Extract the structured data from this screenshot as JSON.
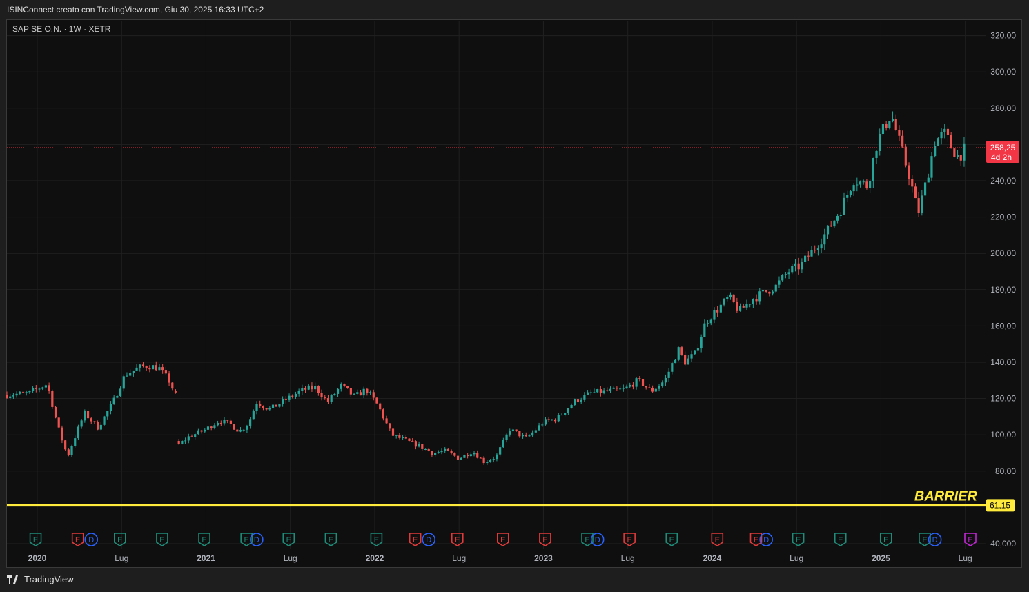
{
  "header": {
    "caption": "ISINConnect creato con TradingView.com, Giu 30, 2025 16:33 UTC+2"
  },
  "footer": {
    "brand": "TradingView"
  },
  "colors": {
    "up": "#26a69a",
    "down": "#ef5350",
    "barrier": "#ffeb3b",
    "price_label_bg": "#f23645",
    "grid": "#1f1f1f",
    "event_e_green": "#1e8c78",
    "event_e_red": "#e03a3a",
    "event_d_blue": "#2962ff",
    "event_e_purple": "#c026d3"
  },
  "chart_data": {
    "type": "candlestick",
    "title": "SAP SE O.N. · 1W · XETR",
    "xlim": [
      2019.82,
      2025.62
    ],
    "ylim": [
      40,
      320
    ],
    "x_ticks": [
      {
        "label": "2020",
        "x": 2020.0,
        "bold": true
      },
      {
        "label": "Lug",
        "x": 2020.5,
        "bold": false
      },
      {
        "label": "2021",
        "x": 2021.0,
        "bold": true
      },
      {
        "label": "Lug",
        "x": 2021.5,
        "bold": false
      },
      {
        "label": "2022",
        "x": 2022.0,
        "bold": true
      },
      {
        "label": "Lug",
        "x": 2022.5,
        "bold": false
      },
      {
        "label": "2023",
        "x": 2023.0,
        "bold": true
      },
      {
        "label": "Lug",
        "x": 2023.5,
        "bold": false
      },
      {
        "label": "2024",
        "x": 2024.0,
        "bold": true
      },
      {
        "label": "Lug",
        "x": 2024.5,
        "bold": false
      },
      {
        "label": "2025",
        "x": 2025.0,
        "bold": true
      },
      {
        "label": "Lug",
        "x": 2025.5,
        "bold": false
      }
    ],
    "y_ticks": [
      {
        "label": "320,00",
        "v": 320
      },
      {
        "label": "300,00",
        "v": 300
      },
      {
        "label": "280,00",
        "v": 280
      },
      {
        "label": "260,00",
        "v": 260
      },
      {
        "label": "240,00",
        "v": 240
      },
      {
        "label": "220,00",
        "v": 220
      },
      {
        "label": "200,00",
        "v": 200
      },
      {
        "label": "180,00",
        "v": 180
      },
      {
        "label": "160,00",
        "v": 160
      },
      {
        "label": "140,00",
        "v": 140
      },
      {
        "label": "120,00",
        "v": 120
      },
      {
        "label": "100,00",
        "v": 100
      },
      {
        "label": "80,00",
        "v": 80
      },
      {
        "label": "40,000",
        "v": 40
      }
    ],
    "anchors": [
      [
        2019.82,
        122
      ],
      [
        2019.95,
        123
      ],
      [
        2020.06,
        128
      ],
      [
        2020.12,
        105
      ],
      [
        2020.18,
        88
      ],
      [
        2020.22,
        98
      ],
      [
        2020.28,
        112
      ],
      [
        2020.36,
        104
      ],
      [
        2020.45,
        118
      ],
      [
        2020.52,
        133
      ],
      [
        2020.6,
        137
      ],
      [
        2020.66,
        138
      ],
      [
        2020.72,
        137
      ],
      [
        2020.78,
        130
      ],
      [
        2020.82,
        122
      ],
      [
        2020.83,
        94
      ],
      [
        2020.9,
        99
      ],
      [
        2021.0,
        103
      ],
      [
        2021.08,
        108
      ],
      [
        2021.14,
        106
      ],
      [
        2021.2,
        102
      ],
      [
        2021.25,
        106
      ],
      [
        2021.3,
        118
      ],
      [
        2021.38,
        114
      ],
      [
        2021.45,
        118
      ],
      [
        2021.52,
        122
      ],
      [
        2021.58,
        125
      ],
      [
        2021.65,
        126
      ],
      [
        2021.72,
        118
      ],
      [
        2021.8,
        127
      ],
      [
        2021.88,
        121
      ],
      [
        2021.95,
        125
      ],
      [
        2022.02,
        116
      ],
      [
        2022.1,
        100
      ],
      [
        2022.18,
        97
      ],
      [
        2022.26,
        94
      ],
      [
        2022.34,
        90
      ],
      [
        2022.42,
        91
      ],
      [
        2022.5,
        87
      ],
      [
        2022.58,
        91
      ],
      [
        2022.65,
        85
      ],
      [
        2022.72,
        88
      ],
      [
        2022.8,
        103
      ],
      [
        2022.9,
        98
      ],
      [
        2023.0,
        107
      ],
      [
        2023.08,
        109
      ],
      [
        2023.18,
        118
      ],
      [
        2023.28,
        123
      ],
      [
        2023.38,
        124
      ],
      [
        2023.48,
        125
      ],
      [
        2023.56,
        130
      ],
      [
        2023.64,
        124
      ],
      [
        2023.72,
        130
      ],
      [
        2023.8,
        147
      ],
      [
        2023.84,
        140
      ],
      [
        2023.9,
        145
      ],
      [
        2023.96,
        162
      ],
      [
        2024.04,
        170
      ],
      [
        2024.1,
        176
      ],
      [
        2024.16,
        168
      ],
      [
        2024.24,
        175
      ],
      [
        2024.3,
        178
      ],
      [
        2024.38,
        182
      ],
      [
        2024.45,
        190
      ],
      [
        2024.52,
        193
      ],
      [
        2024.6,
        202
      ],
      [
        2024.68,
        212
      ],
      [
        2024.76,
        224
      ],
      [
        2024.84,
        241
      ],
      [
        2024.92,
        237
      ],
      [
        2024.98,
        262
      ],
      [
        2025.06,
        277
      ],
      [
        2025.12,
        258
      ],
      [
        2025.17,
        242
      ],
      [
        2025.22,
        222
      ],
      [
        2025.27,
        240
      ],
      [
        2025.32,
        262
      ],
      [
        2025.38,
        266
      ],
      [
        2025.42,
        258
      ],
      [
        2025.46,
        253
      ],
      [
        2025.5,
        258
      ]
    ],
    "gap_x": 2020.83,
    "last_price": {
      "value": 258.25,
      "label": "258,25",
      "countdown": "4d 2h"
    },
    "barrier": {
      "value": 61.15,
      "label": "61,15",
      "text": "BARRIER"
    },
    "events": [
      {
        "t": "E",
        "x": 2019.99,
        "c": "green"
      },
      {
        "t": "E",
        "x": 2020.24,
        "c": "red"
      },
      {
        "t": "D",
        "x": 2020.32,
        "c": "blue"
      },
      {
        "t": "E",
        "x": 2020.49,
        "c": "green"
      },
      {
        "t": "E",
        "x": 2020.74,
        "c": "green"
      },
      {
        "t": "E",
        "x": 2020.99,
        "c": "green"
      },
      {
        "t": "E",
        "x": 2021.24,
        "c": "green"
      },
      {
        "t": "D",
        "x": 2021.3,
        "c": "blue"
      },
      {
        "t": "E",
        "x": 2021.49,
        "c": "green"
      },
      {
        "t": "E",
        "x": 2021.74,
        "c": "green"
      },
      {
        "t": "E",
        "x": 2022.01,
        "c": "green"
      },
      {
        "t": "E",
        "x": 2022.24,
        "c": "red"
      },
      {
        "t": "D",
        "x": 2022.32,
        "c": "blue"
      },
      {
        "t": "E",
        "x": 2022.49,
        "c": "red"
      },
      {
        "t": "E",
        "x": 2022.76,
        "c": "red"
      },
      {
        "t": "E",
        "x": 2023.01,
        "c": "red"
      },
      {
        "t": "E",
        "x": 2023.26,
        "c": "green"
      },
      {
        "t": "D",
        "x": 2023.32,
        "c": "blue"
      },
      {
        "t": "E",
        "x": 2023.51,
        "c": "red"
      },
      {
        "t": "E",
        "x": 2023.76,
        "c": "green"
      },
      {
        "t": "E",
        "x": 2024.03,
        "c": "red"
      },
      {
        "t": "E",
        "x": 2024.26,
        "c": "red"
      },
      {
        "t": "D",
        "x": 2024.32,
        "c": "blue"
      },
      {
        "t": "E",
        "x": 2024.51,
        "c": "green"
      },
      {
        "t": "E",
        "x": 2024.76,
        "c": "green"
      },
      {
        "t": "E",
        "x": 2025.03,
        "c": "green"
      },
      {
        "t": "E",
        "x": 2025.26,
        "c": "green"
      },
      {
        "t": "D",
        "x": 2025.32,
        "c": "blue"
      },
      {
        "t": "E",
        "x": 2025.53,
        "c": "purple"
      }
    ]
  }
}
